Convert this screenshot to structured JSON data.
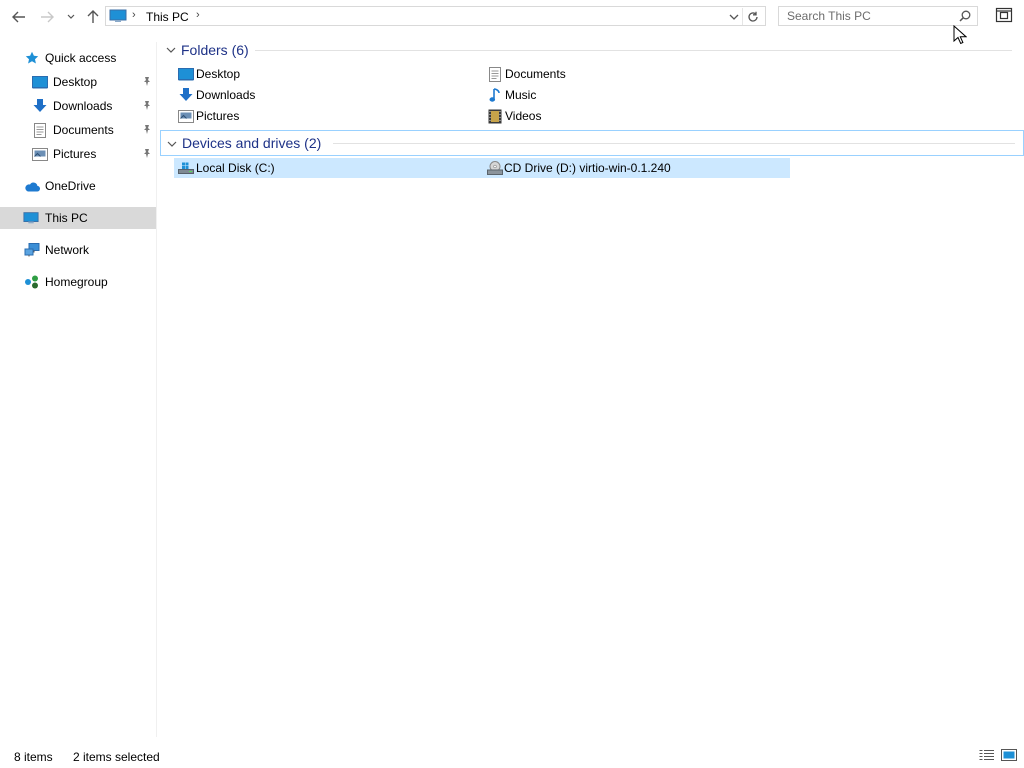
{
  "window": {
    "title": "This PC"
  },
  "toolbar": {
    "back_icon": "arrow-left-icon",
    "forward_icon": "arrow-right-icon",
    "recent_icon": "chevron-down-icon",
    "up_icon": "arrow-up-icon"
  },
  "address": {
    "crumbs": [
      "This PC"
    ],
    "icon": "computer-icon"
  },
  "search": {
    "placeholder": "Search This PC"
  },
  "nav": {
    "items": [
      {
        "label": "Quick access",
        "icon": "star-icon"
      },
      {
        "label": "Desktop",
        "icon": "desktop-icon",
        "pinned": true
      },
      {
        "label": "Downloads",
        "icon": "download-arrow-icon",
        "pinned": true
      },
      {
        "label": "Documents",
        "icon": "document-icon",
        "pinned": true
      },
      {
        "label": "Pictures",
        "icon": "pictures-icon",
        "pinned": true
      },
      {
        "label": "OneDrive",
        "icon": "cloud-icon"
      },
      {
        "label": "This PC",
        "icon": "computer-icon",
        "selected": true
      },
      {
        "label": "Network",
        "icon": "network-icon"
      },
      {
        "label": "Homegroup",
        "icon": "homegroup-icon"
      }
    ]
  },
  "content": {
    "folders_header": "Folders (6)",
    "folders": [
      {
        "label": "Desktop",
        "icon": "desktop-icon"
      },
      {
        "label": "Downloads",
        "icon": "download-arrow-icon"
      },
      {
        "label": "Pictures",
        "icon": "pictures-icon"
      },
      {
        "label": "Documents",
        "icon": "document-icon"
      },
      {
        "label": "Music",
        "icon": "music-note-icon"
      },
      {
        "label": "Videos",
        "icon": "film-icon"
      }
    ],
    "drives_header": "Devices and drives (2)",
    "drives": [
      {
        "label": "Local Disk (C:)",
        "icon": "hard-drive-icon",
        "selected": true
      },
      {
        "label": "CD Drive (D:) virtio-win-0.1.240",
        "icon": "cd-drive-icon",
        "selected": true
      }
    ]
  },
  "status": {
    "item_count": "8 items",
    "selection": "2 items selected"
  },
  "colors": {
    "selection": "#cce8ff",
    "nav_selected": "#d9d9d9",
    "group_title": "#1e3287",
    "accent_blue": "#0078d7"
  }
}
